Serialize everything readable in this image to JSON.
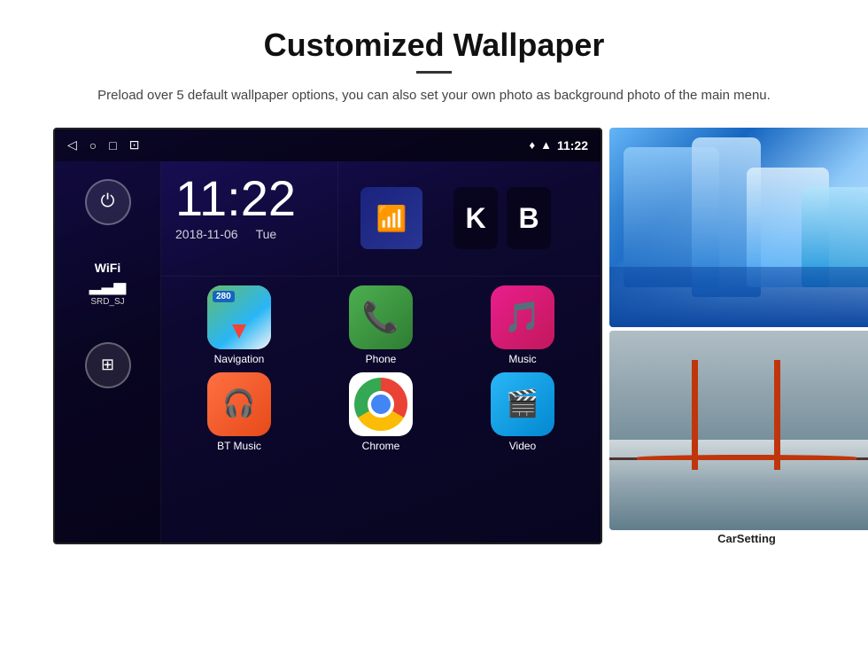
{
  "page": {
    "title": "Customized Wallpaper",
    "subtitle": "Preload over 5 default wallpaper options, you can also set your own photo as background photo of the main menu.",
    "divider": "—"
  },
  "statusBar": {
    "time": "11:22",
    "navIcons": [
      "◁",
      "○",
      "□",
      "⊡"
    ],
    "rightIcons": [
      "location",
      "wifi",
      "time"
    ]
  },
  "clock": {
    "time": "11:22",
    "date": "2018-11-06",
    "day": "Tue"
  },
  "sidebar": {
    "powerLabel": "⏻",
    "wifiLabel": "WiFi",
    "wifiBars": "▂▃▅",
    "wifiName": "SRD_SJ",
    "appsIcon": "⊞"
  },
  "apps": [
    {
      "name": "Navigation",
      "type": "navigation"
    },
    {
      "name": "Phone",
      "type": "phone"
    },
    {
      "name": "Music",
      "type": "music"
    },
    {
      "name": "BT Music",
      "type": "btmusic"
    },
    {
      "name": "Chrome",
      "type": "chrome"
    },
    {
      "name": "Video",
      "type": "video"
    }
  ],
  "wallpapers": [
    {
      "name": "ice-cave",
      "label": ""
    },
    {
      "name": "golden-gate",
      "label": "CarSetting"
    }
  ]
}
